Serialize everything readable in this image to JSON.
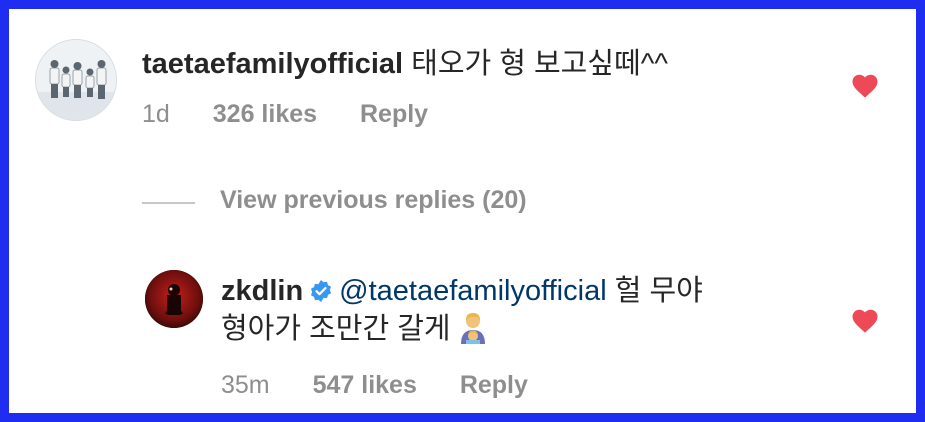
{
  "colors": {
    "frame": "#1f2df0",
    "heart": "#ed4956",
    "muted": "#8e8e8e",
    "text": "#262626",
    "mention": "#00376b",
    "verified": "#3897f0"
  },
  "comment": {
    "username": "taetaefamilyofficial",
    "text": "태오가 형 보고싶떼^^",
    "time": "1d",
    "likes": "326 likes",
    "reply_label": "Reply",
    "liked": true
  },
  "view_previous": "View previous replies (20)",
  "reply": {
    "username": "zkdlin",
    "verified": true,
    "mention": "@taetaefamilyofficial",
    "text_line1": "헐 무야",
    "text_line2": "형아가 조만간 갈게",
    "emoji": "man-with-baby-emoji",
    "time": "35m",
    "likes": "547 likes",
    "reply_label": "Reply",
    "liked": true
  }
}
